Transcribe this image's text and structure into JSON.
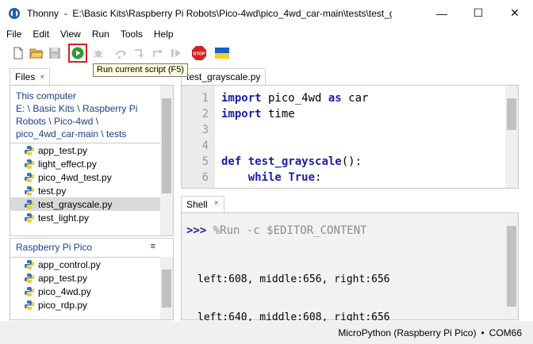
{
  "window": {
    "app_name": "Thonny",
    "path": "E:\\Basic Kits\\Raspberry Pi Robots\\Pico-4wd\\pico_4wd_car-main\\tests\\test_gray...",
    "minimize": "—",
    "maximize": "☐",
    "close": "✕"
  },
  "menu": [
    "File",
    "Edit",
    "View",
    "Run",
    "Tools",
    "Help"
  ],
  "toolbar": {
    "tooltip": "Run current script (F5)",
    "stop_label": "STOP"
  },
  "files_pane": {
    "tab": "Files",
    "close": "×",
    "location_label": "This computer",
    "path_lines": [
      "E: \\ Basic Kits \\ Raspberry Pi",
      "Robots \\ Pico-4wd \\",
      "pico_4wd_car-main \\ tests"
    ],
    "files": [
      "app_test.py",
      "light_effect.py",
      "pico_4wd_test.py",
      "test.py",
      "test_grayscale.py",
      "test_light.py"
    ],
    "selected": "test_grayscale.py"
  },
  "pico_pane": {
    "title": "Raspberry Pi Pico",
    "files": [
      "app_control.py",
      "app_test.py",
      "pico_4wd.py",
      "pico_rdp.py"
    ]
  },
  "editor": {
    "tab": "test_grayscale.py",
    "line_numbers": [
      "1",
      "2",
      "3",
      "4",
      "5",
      "6"
    ],
    "lines": [
      {
        "kw": "import",
        "rest": " pico_4wd ",
        "kw2": "as",
        "rest2": " car"
      },
      {
        "kw": "import",
        "rest": " time",
        "kw2": "",
        "rest2": ""
      },
      {
        "kw": "",
        "rest": "",
        "kw2": "",
        "rest2": ""
      },
      {
        "kw": "",
        "rest": "",
        "kw2": "",
        "rest2": ""
      },
      {
        "kw": "def",
        "rest": " ",
        "fn": "test_grayscale",
        "rest2": "():"
      },
      {
        "indent": "    ",
        "kw": "while",
        "rest": " ",
        "kw2": "True",
        "rest2": ":"
      }
    ]
  },
  "shell": {
    "tab": "Shell",
    "close": "×",
    "prompt": ">>>",
    "command": " %Run -c $EDITOR_CONTENT",
    "output": [
      "left:608, middle:656, right:656",
      "left:640, middle:608, right:656"
    ]
  },
  "status": {
    "interpreter": "MicroPython (Raspberry Pi Pico)",
    "separator": "•",
    "port": "COM66"
  }
}
